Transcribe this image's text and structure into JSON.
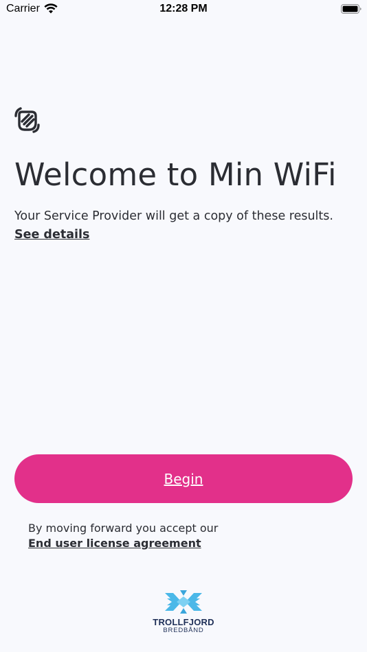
{
  "status_bar": {
    "carrier": "Carrier",
    "time": "12:28 PM"
  },
  "welcome": {
    "icon": "waving-hand-icon",
    "title": "Welcome to Min WiFi",
    "intro": "Your Service Provider will get a copy of these results.",
    "details_link": "See details"
  },
  "actions": {
    "begin_label": "Begin",
    "accept_text": "By moving forward you accept our",
    "eula_link": "End user license agreement"
  },
  "footer": {
    "brand_name": "TROLLFJORD",
    "brand_sub": "BREDBÅND"
  },
  "colors": {
    "background": "#f8f9fd",
    "text": "#2b2d33",
    "accent": "#e2308a",
    "brand_navy": "#1e2f57",
    "brand_blue": "#4bb8e8"
  }
}
